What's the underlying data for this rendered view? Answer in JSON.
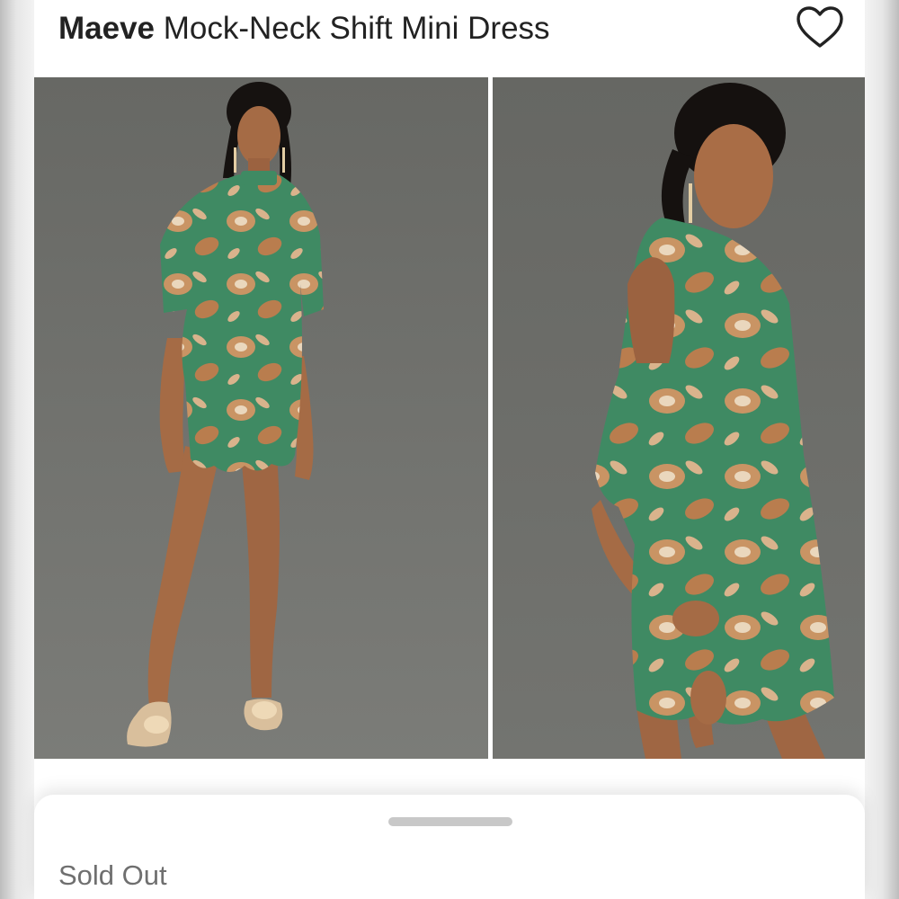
{
  "product": {
    "brand": "Maeve",
    "name": " Mock-Neck Shift Mini Dress",
    "favorite_icon": "heart-outline-icon"
  },
  "gallery": {
    "images": [
      {
        "view": "front"
      },
      {
        "view": "back"
      }
    ]
  },
  "sheet": {
    "status": "Sold Out"
  },
  "colors": {
    "dress_green": "#3f8a63",
    "print_tan": "#c99464",
    "background_gray": "#6a6b67"
  }
}
